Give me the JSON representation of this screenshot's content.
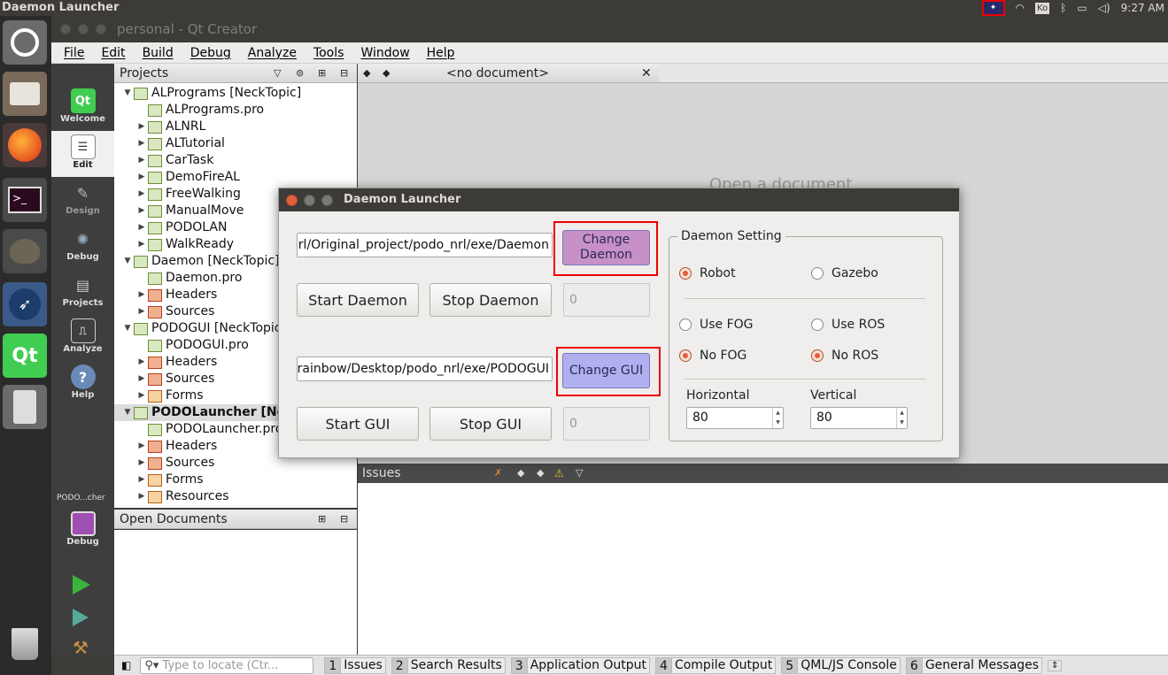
{
  "topbar": {
    "app_title": "Daemon Launcher",
    "keyboard": "Ko",
    "time": "9:27 AM"
  },
  "window": {
    "title": "personal - Qt Creator"
  },
  "menu": [
    "File",
    "Edit",
    "Build",
    "Debug",
    "Analyze",
    "Tools",
    "Window",
    "Help"
  ],
  "modes": [
    {
      "label": "Welcome",
      "icon": "qt-welcome-icon"
    },
    {
      "label": "Edit",
      "icon": "edit-icon"
    },
    {
      "label": "Design",
      "icon": "design-icon"
    },
    {
      "label": "Debug",
      "icon": "debug-icon"
    },
    {
      "label": "Projects",
      "icon": "projects-icon"
    },
    {
      "label": "Analyze",
      "icon": "analyze-icon"
    },
    {
      "label": "Help",
      "icon": "help-icon"
    }
  ],
  "kit": {
    "name": "PODO...cher",
    "mode": "Debug"
  },
  "projects_panel": {
    "title": "Projects"
  },
  "tree": [
    {
      "label": "ALPrograms [NeckTopic]",
      "level": 0,
      "expanded": true
    },
    {
      "label": "ALPrograms.pro",
      "level": 1
    },
    {
      "label": "ALNRL",
      "level": 1,
      "arrow": true
    },
    {
      "label": "ALTutorial",
      "level": 1,
      "arrow": true
    },
    {
      "label": "CarTask",
      "level": 1,
      "arrow": true
    },
    {
      "label": "DemoFireAL",
      "level": 1,
      "arrow": true
    },
    {
      "label": "FreeWalking",
      "level": 1,
      "arrow": true
    },
    {
      "label": "ManualMove",
      "level": 1,
      "arrow": true
    },
    {
      "label": "PODOLAN",
      "level": 1,
      "arrow": true
    },
    {
      "label": "WalkReady",
      "level": 1,
      "arrow": true
    },
    {
      "label": "Daemon [NeckTopic]",
      "level": 0,
      "expanded": true
    },
    {
      "label": "Daemon.pro",
      "level": 1
    },
    {
      "label": "Headers",
      "level": 1,
      "arrow": true,
      "kind": "red"
    },
    {
      "label": "Sources",
      "level": 1,
      "arrow": true,
      "kind": "red"
    },
    {
      "label": "PODOGUI [NeckTopic]",
      "level": 0,
      "expanded": true
    },
    {
      "label": "PODOGUI.pro",
      "level": 1
    },
    {
      "label": "Headers",
      "level": 1,
      "arrow": true,
      "kind": "red"
    },
    {
      "label": "Sources",
      "level": 1,
      "arrow": true,
      "kind": "red"
    },
    {
      "label": "Forms",
      "level": 1,
      "arrow": true,
      "kind": "form"
    },
    {
      "label": "PODOLauncher [NeckTopic]",
      "level": 0,
      "expanded": true,
      "selected": true
    },
    {
      "label": "PODOLauncher.pro",
      "level": 1
    },
    {
      "label": "Headers",
      "level": 1,
      "arrow": true,
      "kind": "red"
    },
    {
      "label": "Sources",
      "level": 1,
      "arrow": true,
      "kind": "red"
    },
    {
      "label": "Forms",
      "level": 1,
      "arrow": true,
      "kind": "form"
    },
    {
      "label": "Resources",
      "level": 1,
      "arrow": true,
      "kind": "form"
    }
  ],
  "editor": {
    "doc_selector": "<no document>",
    "placeholder": "Open a document"
  },
  "open_documents": {
    "title": "Open Documents"
  },
  "issues": {
    "title": "Issues"
  },
  "locator": {
    "placeholder": "Type to locate (Ctr..."
  },
  "output_tabs": [
    {
      "num": "1",
      "label": "Issues"
    },
    {
      "num": "2",
      "label": "Search Results"
    },
    {
      "num": "3",
      "label": "Application Output"
    },
    {
      "num": "4",
      "label": "Compile Output"
    },
    {
      "num": "5",
      "label": "QML/JS Console"
    },
    {
      "num": "6",
      "label": "General Messages"
    }
  ],
  "dialog": {
    "title": "Daemon Launcher",
    "daemon_path": "/home/rainbow/Desktop/podo_nrl/Original_project/podo_nrl/exe/Daemon",
    "change_daemon": "Change Daemon",
    "start_daemon": "Start Daemon",
    "stop_daemon": "Stop Daemon",
    "daemon_pid": "0",
    "gui_path": "/home/rainbow/Desktop/podo_nrl/exe/PODOGUI",
    "change_gui": "Change GUI",
    "start_gui": "Start GUI",
    "stop_gui": "Stop GUI",
    "gui_pid": "0",
    "settings": {
      "title": "Daemon Setting",
      "robot": "Robot",
      "gazebo": "Gazebo",
      "use_fog": "Use FOG",
      "use_ros": "Use ROS",
      "no_fog": "No FOG",
      "no_ros": "No ROS",
      "horizontal_label": "Horizontal",
      "vertical_label": "Vertical",
      "horizontal": "80",
      "vertical": "80"
    }
  }
}
